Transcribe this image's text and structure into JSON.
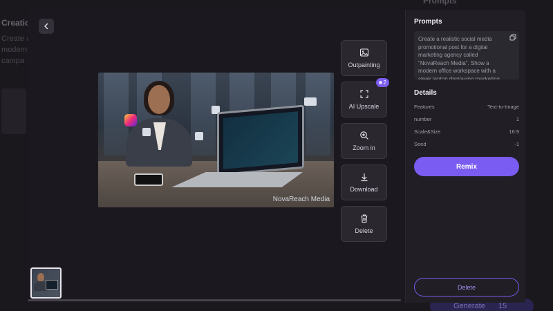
{
  "background": {
    "title": "Creatio",
    "lines": [
      "Create a",
      "modern",
      "campa"
    ],
    "top_prompts": "Prompts",
    "generate_label": "Generate",
    "generate_count": "15"
  },
  "viewer": {
    "back_icon": "chevron-left-icon",
    "image_watermark": "NovaReach Media",
    "tools": [
      {
        "label": "Outpainting",
        "icon": "outpainting-icon"
      },
      {
        "label": "AI Upscale",
        "icon": "expand-icon",
        "badge": "2"
      },
      {
        "label": "Zoom in",
        "icon": "zoom-in-icon"
      },
      {
        "label": "Download",
        "icon": "download-icon"
      },
      {
        "label": "Delete",
        "icon": "trash-icon"
      }
    ]
  },
  "panel": {
    "prompts_title": "Prompts",
    "prompt_text": "Create a realistic social media promotional post for a digital marketing agency called \"NovaReach Media\". Show a modern office workspace with a sleek laptop displaying marketing",
    "details_title": "Details",
    "details": [
      {
        "label": "Features",
        "value": "Text-to-Image"
      },
      {
        "label": "number",
        "value": "1"
      },
      {
        "label": "Scale&Size",
        "value": "16:9"
      },
      {
        "label": "Seed",
        "value": "-1"
      }
    ],
    "remix_label": "Remix",
    "delete_label": "Delete"
  },
  "colors": {
    "accent": "#7b5cf2",
    "modal_bg": "#1c1a20",
    "panel_bg": "#211f25"
  }
}
